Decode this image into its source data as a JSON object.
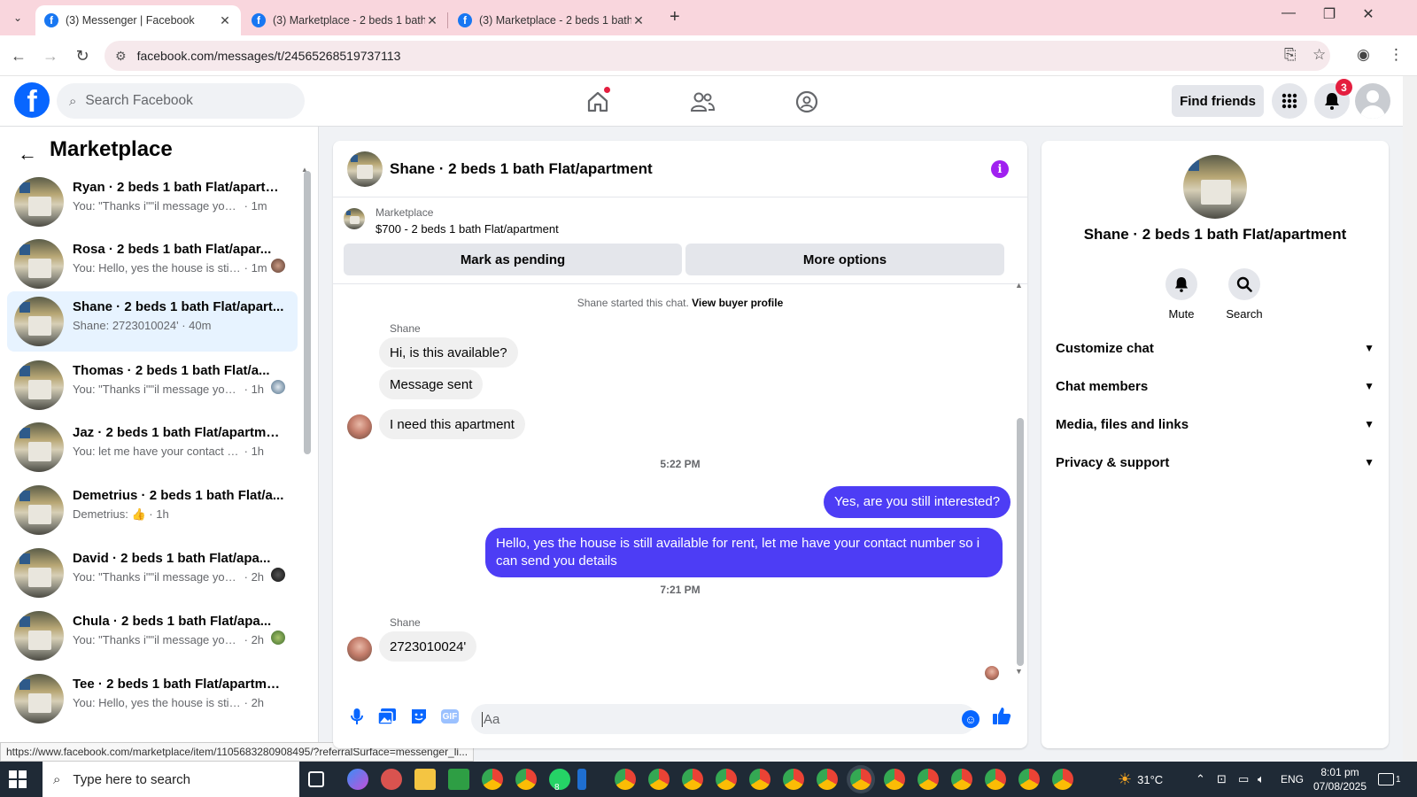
{
  "browser": {
    "tabs": [
      {
        "title": "(3) Messenger | Facebook",
        "active": true
      },
      {
        "title": "(3) Marketplace - 2 beds 1 bath",
        "active": false
      },
      {
        "title": "(3) Marketplace - 2 beds 1 bath",
        "active": false
      }
    ],
    "url": "facebook.com/messages/t/24565268519737113",
    "status_url": "https://www.facebook.com/marketplace/item/1105683280908495/?referralSurface=messenger_li..."
  },
  "fb_header": {
    "search_placeholder": "Search Facebook",
    "find_friends_label": "Find friends",
    "notification_count": "3"
  },
  "left_panel": {
    "title": "Marketplace",
    "conversations": [
      {
        "name": "Ryan · 2 beds 1 bath Flat/apartm...",
        "preview": "You: \"Thanks i\"\"il message you in a...",
        "time": "· 1m",
        "selected": false
      },
      {
        "name": "Rosa · 2 beds 1 bath Flat/apar...",
        "preview": "You: Hello, yes the house is still ...",
        "time": "· 1m",
        "selected": false
      },
      {
        "name": "Shane · 2 beds 1 bath Flat/apart...",
        "preview": "Shane: 2723010024'",
        "time": "· 40m",
        "selected": true
      },
      {
        "name": "Thomas · 2 beds 1 bath Flat/a...",
        "preview": "You: \"Thanks i\"\"il message you i...",
        "time": "· 1h",
        "selected": false
      },
      {
        "name": "Jaz · 2 beds 1 bath Flat/apartment",
        "preview": "You: let me have your contact num...",
        "time": "· 1h",
        "selected": false
      },
      {
        "name": "Demetrius · 2 beds 1 bath Flat/a...",
        "preview": "Demetrius: 👍",
        "time": "· 1h",
        "selected": false
      },
      {
        "name": "David · 2 beds 1 bath Flat/apa...",
        "preview": "You: \"Thanks i\"\"il message you i...",
        "time": "· 2h",
        "selected": false
      },
      {
        "name": "Chula · 2 beds 1 bath Flat/apa...",
        "preview": "You: \"Thanks i\"\"il message you i...",
        "time": "· 2h",
        "selected": false
      },
      {
        "name": "Tee · 2 beds 1 bath Flat/apartment",
        "preview": "You: Hello, yes the house is still avai...",
        "time": "· 2h",
        "selected": false
      }
    ]
  },
  "chat": {
    "title": "Shane · 2 beds 1 bath Flat/apartment",
    "marketplace_label": "Marketplace",
    "listing": "$700 - 2 beds 1 bath Flat/apartment",
    "mark_pending_label": "Mark as pending",
    "more_options_label": "More options",
    "started_text": "Shane started this chat.",
    "view_buyer_profile": "View buyer profile",
    "sender_name": "Shane",
    "messages_in_1": [
      "Hi, is this available?",
      "Message sent",
      "I need this apartment"
    ],
    "time_1": "5:22 PM",
    "messages_out": [
      "Yes, are you still interested?",
      "Hello, yes the house is still available for rent, let me have your contact number so i can send you details"
    ],
    "time_2": "7:21 PM",
    "message_in_2": "2723010024'",
    "composer_placeholder": "Aa"
  },
  "right_panel": {
    "name": "Shane · 2 beds 1 bath Flat/apartment",
    "mute_label": "Mute",
    "search_label": "Search",
    "sections": [
      "Customize chat",
      "Chat members",
      "Media, files and links",
      "Privacy & support"
    ]
  },
  "taskbar": {
    "search_placeholder": "Type here to search",
    "temperature": "31°C",
    "language": "ENG",
    "time": "8:01 pm",
    "date": "07/08/2025",
    "notification_count": "1",
    "whatsapp_badge": "8"
  },
  "colors": {
    "fb_blue": "#0866ff",
    "outgoing_bubble": "#4d3df5",
    "selected_conv": "#e7f3ff",
    "tab_strip": "#f9d6dd"
  }
}
